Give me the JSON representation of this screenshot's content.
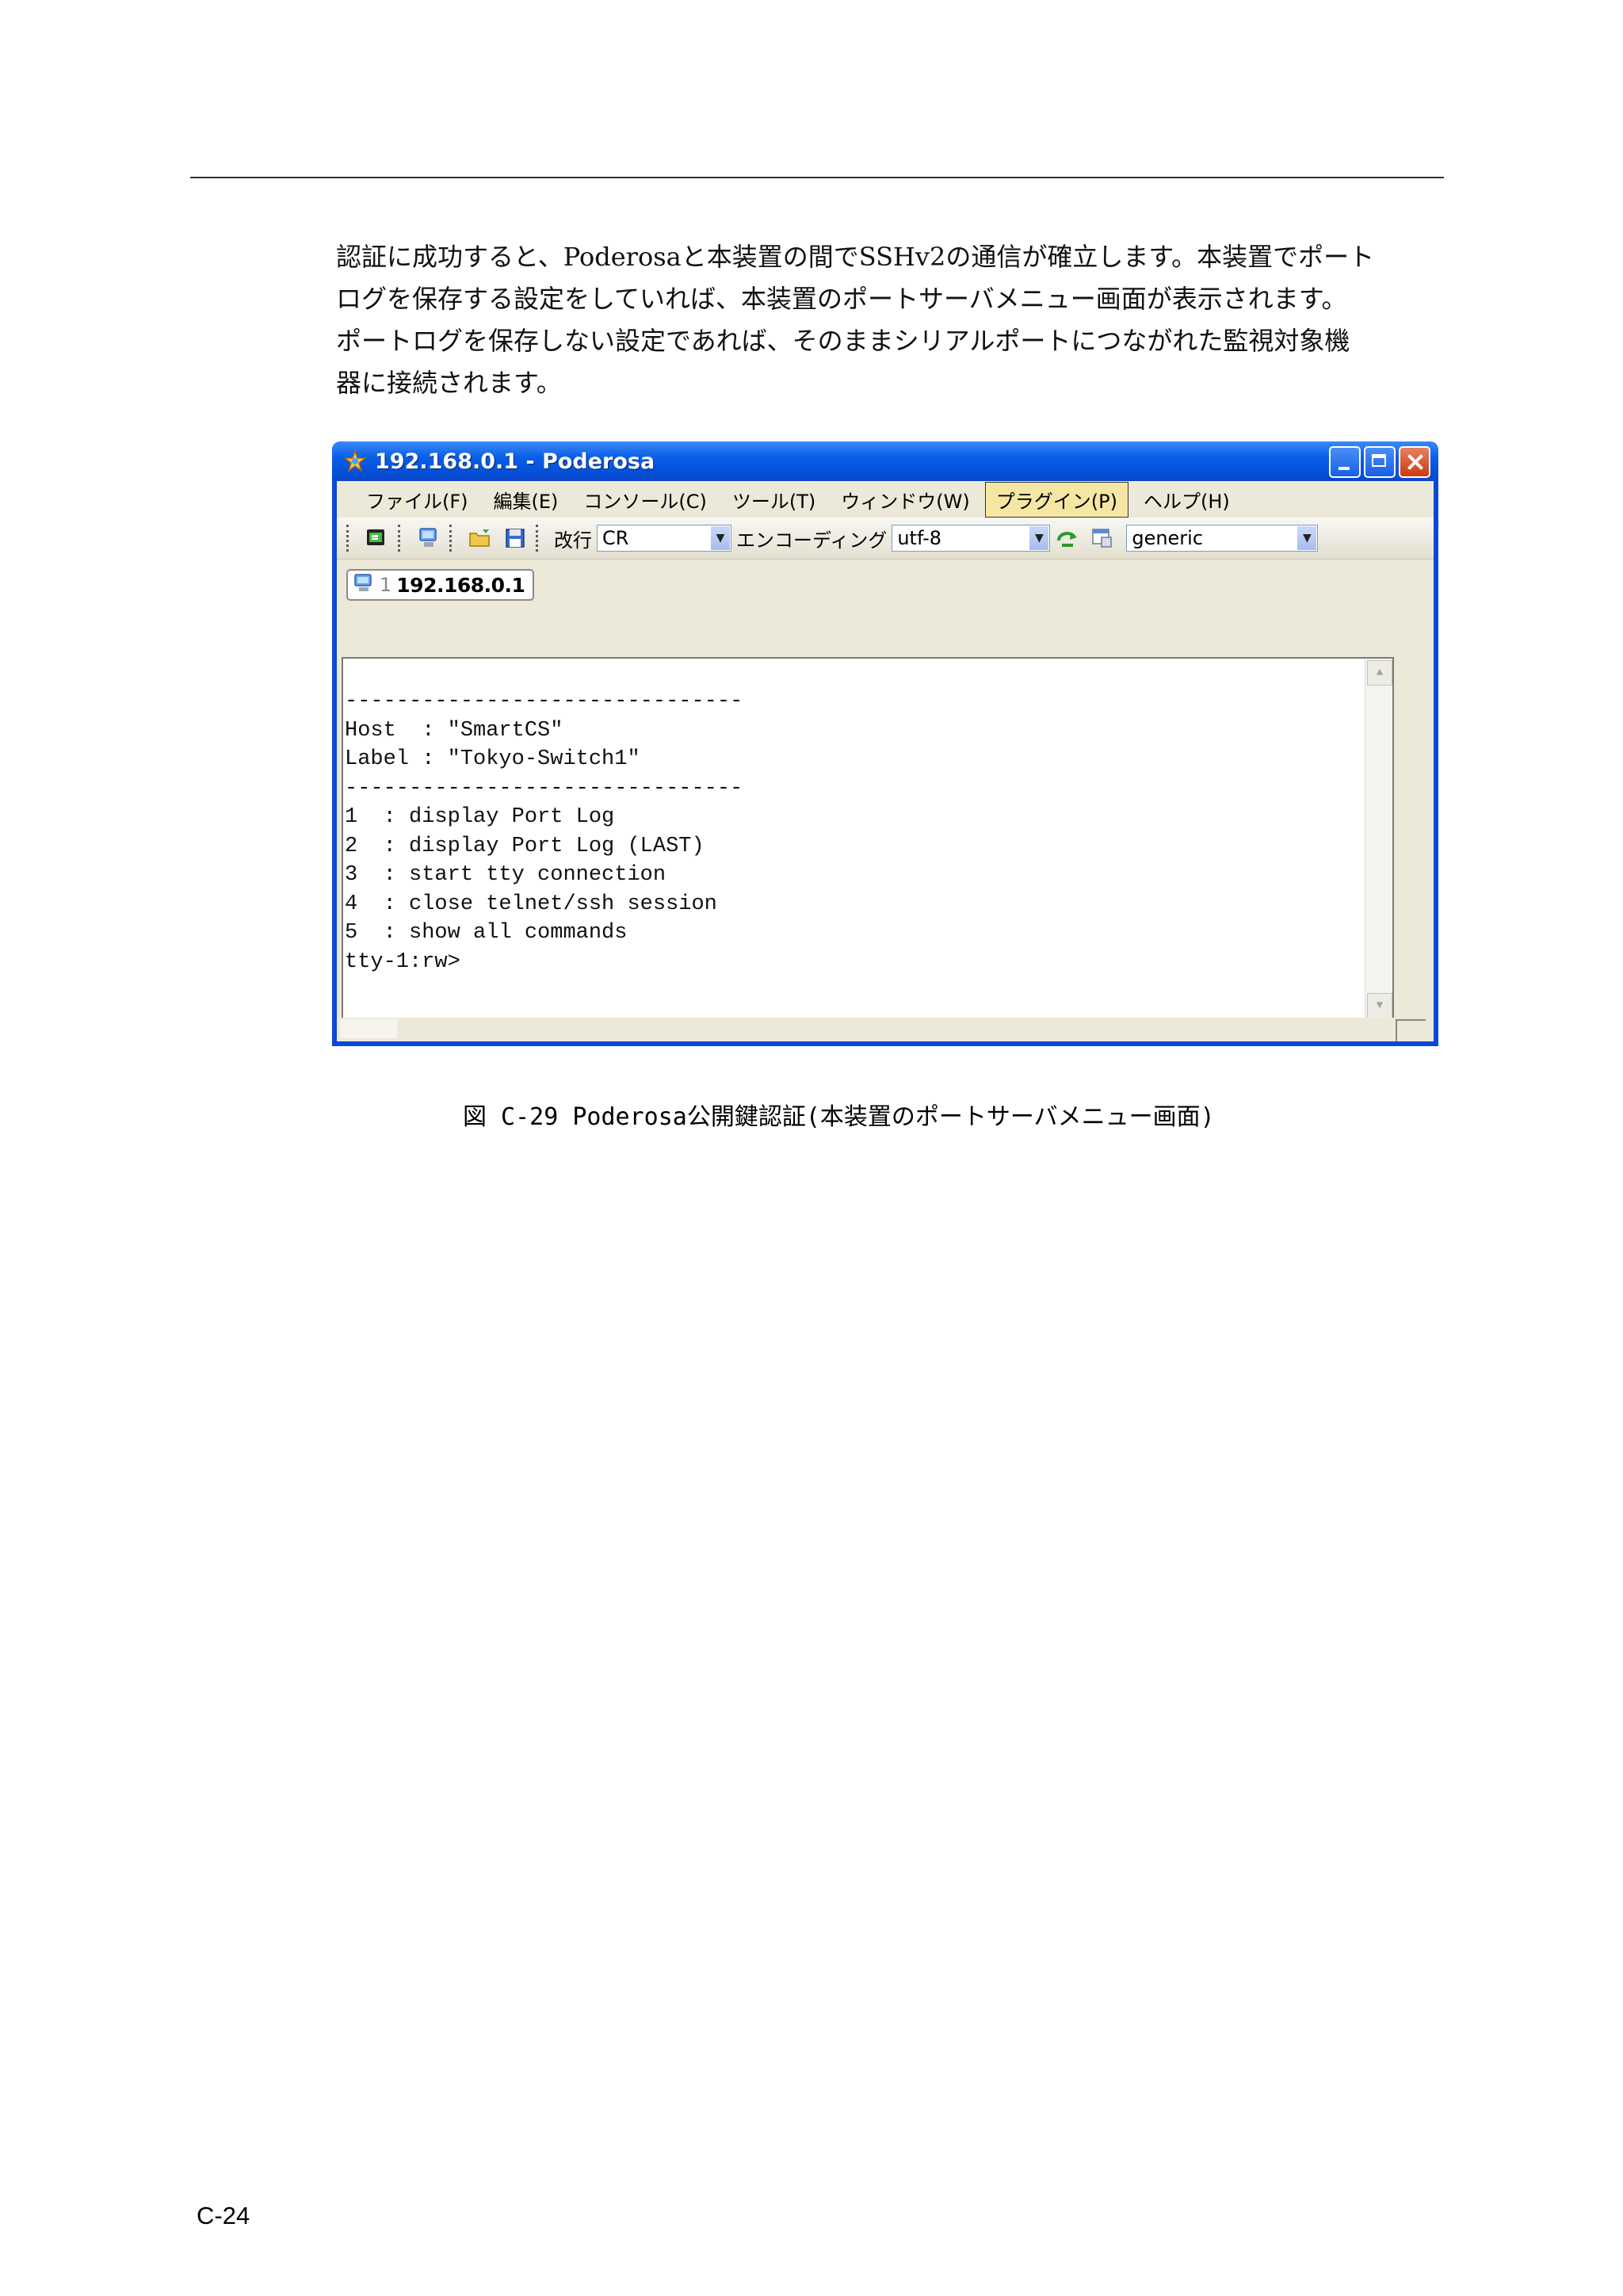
{
  "body_text": {
    "lines": [
      "認証に成功すると、Poderosaと本装置の間でSSHv2の通信が確立します。本装置でポート",
      "ログを保存する設定をしていれば、本装置のポートサーバメニュー画面が表示されます。",
      "ポートログを保存しない設定であれば、そのままシリアルポートにつながれた監視対象機",
      "器に接続されます。"
    ]
  },
  "window": {
    "title": "192.168.0.1 - Poderosa",
    "menu": [
      "ファイル(F)",
      "編集(E)",
      "コンソール(C)",
      "ツール(T)",
      "ウィンドウ(W)",
      "プラグイン(P)",
      "ヘルプ(H)"
    ],
    "toolbar": {
      "newline_label": "改行",
      "newline_value": "CR",
      "encoding_label": "エンコーディング",
      "encoding_value": "utf-8",
      "terminal_type_value": "generic"
    },
    "tab": {
      "number": "1",
      "label": "192.168.0.1"
    },
    "terminal_lines": [
      "-------------------------------",
      "Host  : \"SmartCS\"",
      "Label : \"Tokyo-Switch1\"",
      "-------------------------------",
      "1  : display Port Log",
      "2  : display Port Log (LAST)",
      "3  : start tty connection",
      "4  : close telnet/ssh session",
      "5  : show all commands",
      "tty-1:rw>"
    ]
  },
  "caption": "図 C-29  Poderosa公開鍵認証(本装置のポートサーバメニュー画面)",
  "page_number": "C-24",
  "colors": {
    "titlebar": "#0a5ee8",
    "window_frame": "#0a48d8",
    "client_bg": "#ece9d8",
    "menu_highlight": "#f5e7a3"
  }
}
